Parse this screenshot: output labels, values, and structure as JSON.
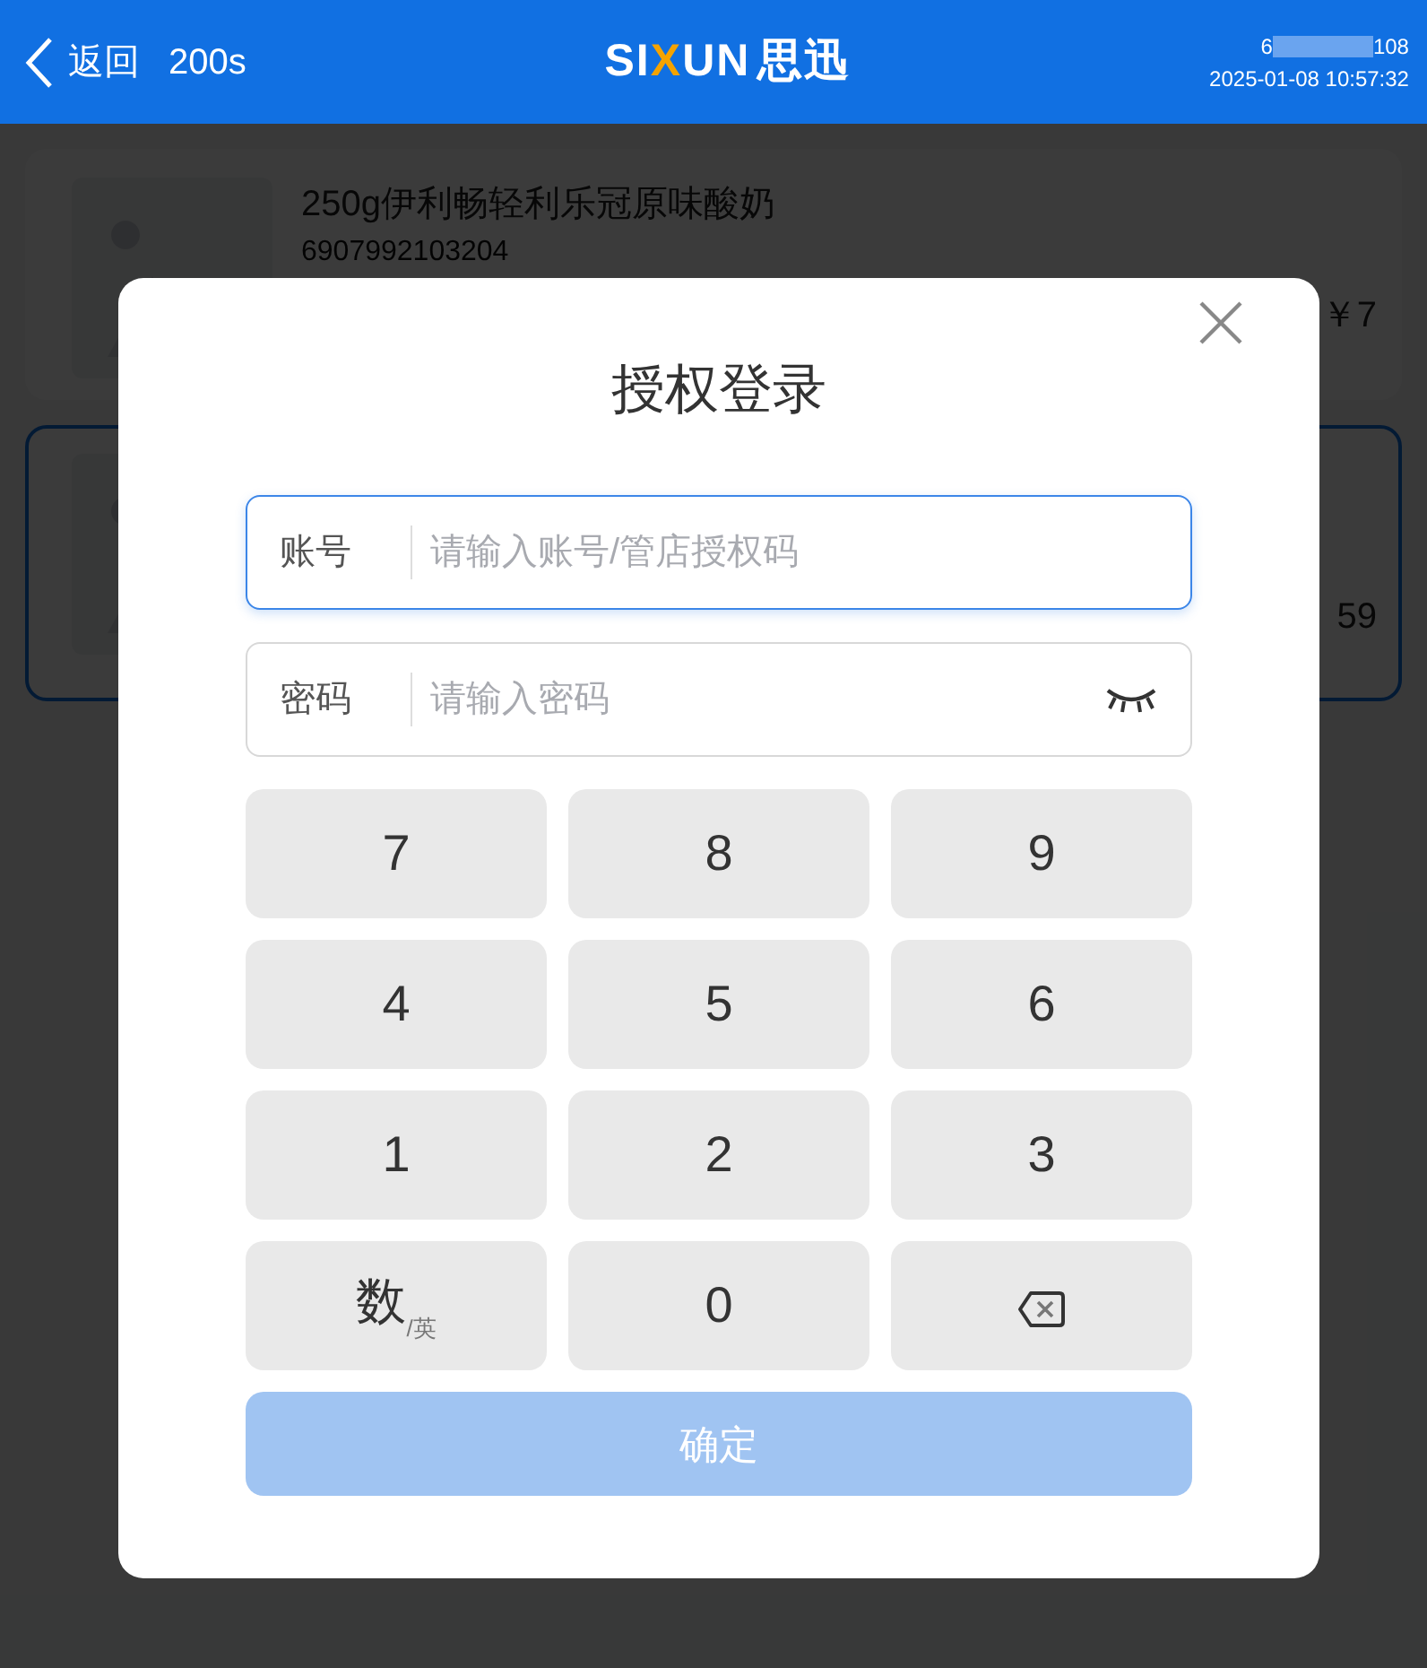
{
  "header": {
    "back_label": "返回",
    "countdown": "200s",
    "logo": {
      "letters": [
        {
          "text": "SI",
          "accent": false
        },
        {
          "text": "X",
          "accent": true
        },
        {
          "text": "UN",
          "accent": false
        }
      ],
      "name": "思迅"
    },
    "phone_start": "6",
    "phone_end": "108",
    "datetime": "2025-01-08 10:57:32"
  },
  "products": [
    {
      "name": "250g伊利畅轻利乐冠原味酸奶",
      "barcode": "6907992103204",
      "price": "￥7",
      "selected": false
    },
    {
      "price": "59",
      "selected": true
    }
  ],
  "dialog": {
    "title": "授权登录",
    "fields": [
      {
        "label": "账号",
        "placeholder": "请输入账号/管店授权码",
        "focused": true,
        "kind": "text"
      },
      {
        "label": "密码",
        "placeholder": "请输入密码",
        "focused": false,
        "masked": true,
        "kind": "password"
      }
    ],
    "keys": [
      {
        "kind": "digit",
        "label": "7"
      },
      {
        "kind": "digit",
        "label": "8"
      },
      {
        "kind": "digit",
        "label": "9"
      },
      {
        "kind": "digit",
        "label": "4"
      },
      {
        "kind": "digit",
        "label": "5"
      },
      {
        "kind": "digit",
        "label": "6"
      },
      {
        "kind": "digit",
        "label": "1"
      },
      {
        "kind": "digit",
        "label": "2"
      },
      {
        "kind": "digit",
        "label": "3"
      },
      {
        "kind": "toggle",
        "label": "数",
        "sub": "/英"
      },
      {
        "kind": "digit",
        "label": "0"
      },
      {
        "kind": "backspace"
      }
    ],
    "confirm": {
      "label": "确定",
      "disabled": true
    }
  }
}
